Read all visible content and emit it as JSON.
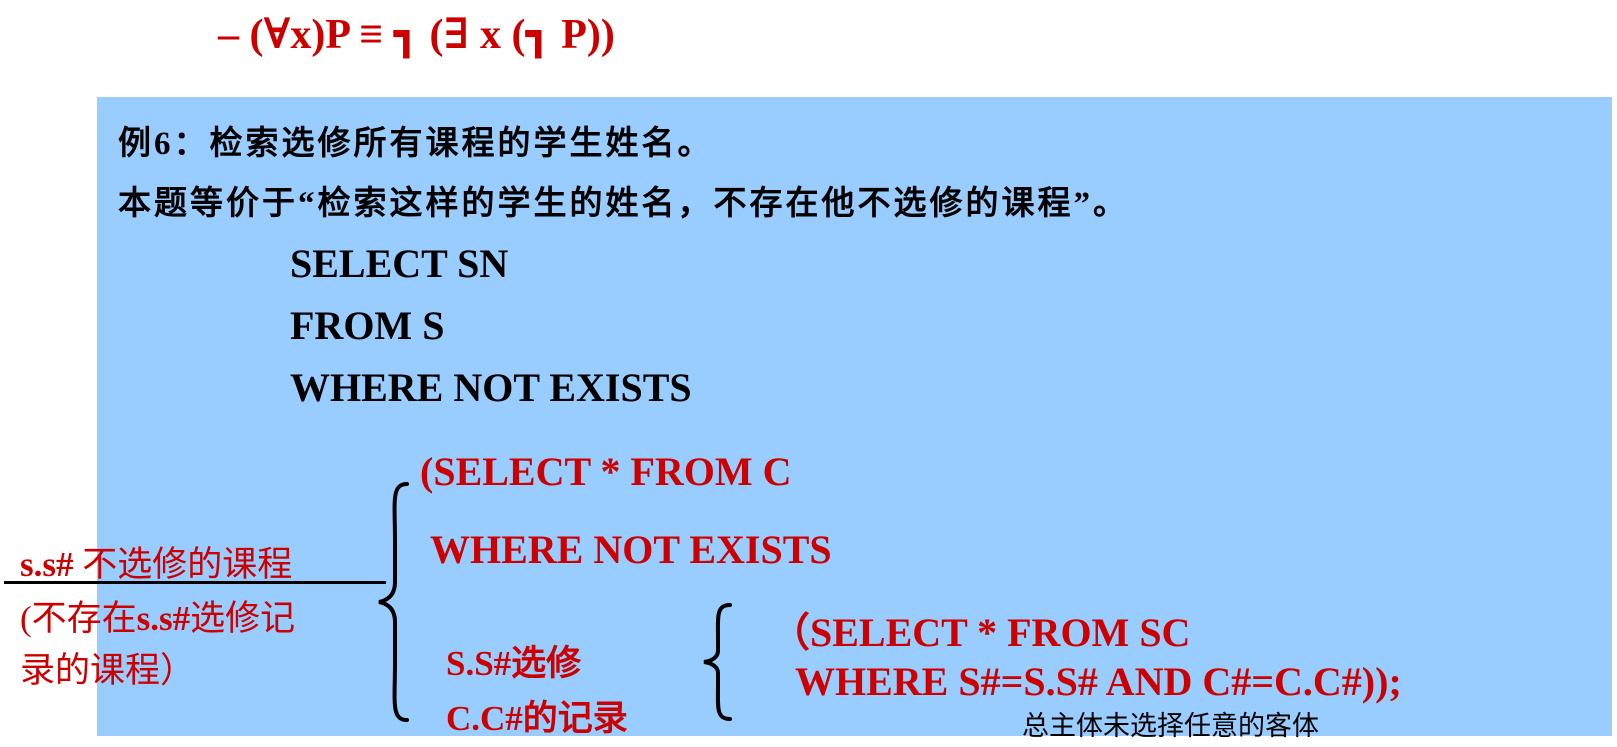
{
  "formula": {
    "text": "–  (∀x)P  ≡ ┓ (∃ x (┓ P))"
  },
  "example": {
    "title": "例6：检索选修所有课程的学生姓名。",
    "restatement": "本题等价于“检索这样的学生的姓名，不存在他不选修的课程”。"
  },
  "sql_outer": {
    "line1": "SELECT  SN",
    "line2": "FROM  S",
    "line3": "WHERE NOT EXISTS"
  },
  "sql_middle": {
    "line1": "(SELECT * FROM C",
    "line2": "WHERE  NOT EXISTS"
  },
  "sql_inner": {
    "line1": "（SELECT *  FROM SC",
    "line2": "WHERE  S#=S.S#  AND C#=C.C#));"
  },
  "inner_note": {
    "line1": "S.S#选修",
    "line2": "C.C#的记录"
  },
  "left_note": {
    "line1_code": "s.s#",
    "line1_text": " 不选修的课程",
    "line2_open": "(不存在",
    "line2_code": "s.s#",
    "line2_text": "选修记",
    "line3": "录的课程）"
  },
  "caption": {
    "text": "总主体未选择任意的客体"
  },
  "colors": {
    "highlight_box": "#99ccff",
    "emphasis_red": "#cc0000",
    "text_black": "#000000"
  }
}
